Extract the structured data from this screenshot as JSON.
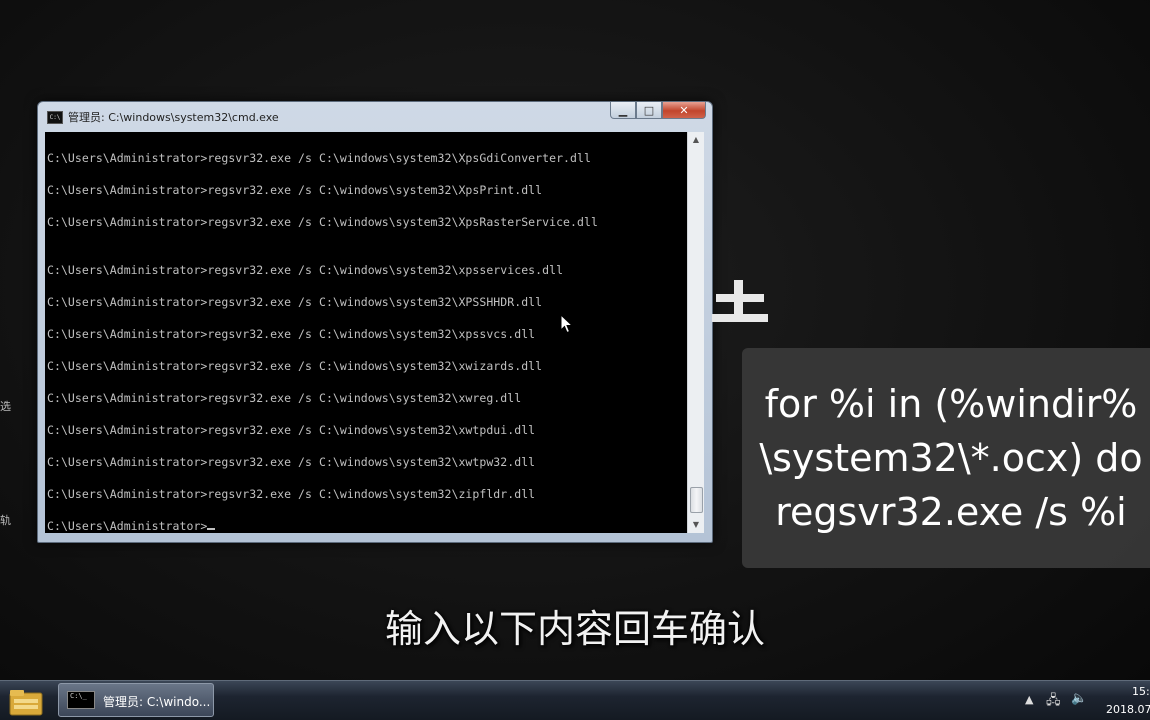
{
  "background": {
    "edge_chars": [
      "选",
      "轨"
    ]
  },
  "cmd_window": {
    "title": "管理员: C:\\windows\\system32\\cmd.exe",
    "icon_label": "C:\\",
    "buttons": {
      "minimize": "▁",
      "maximize": "□",
      "close": "✕"
    },
    "console_lines": [
      "C:\\Users\\Administrator>regsvr32.exe /s C:\\windows\\system32\\XpsGdiConverter.dll",
      "C:\\Users\\Administrator>regsvr32.exe /s C:\\windows\\system32\\XpsPrint.dll",
      "C:\\Users\\Administrator>regsvr32.exe /s C:\\windows\\system32\\XpsRasterService.dll",
      "C:\\Users\\Administrator>regsvr32.exe /s C:\\windows\\system32\\xpsservices.dll",
      "C:\\Users\\Administrator>regsvr32.exe /s C:\\windows\\system32\\XPSSHHDR.dll",
      "C:\\Users\\Administrator>regsvr32.exe /s C:\\windows\\system32\\xpssvcs.dll",
      "C:\\Users\\Administrator>regsvr32.exe /s C:\\windows\\system32\\xwizards.dll",
      "C:\\Users\\Administrator>regsvr32.exe /s C:\\windows\\system32\\xwreg.dll",
      "C:\\Users\\Administrator>regsvr32.exe /s C:\\windows\\system32\\xwtpdui.dll",
      "C:\\Users\\Administrator>regsvr32.exe /s C:\\windows\\system32\\xwtpw32.dll",
      "C:\\Users\\Administrator>regsvr32.exe /s C:\\windows\\system32\\zipfldr.dll"
    ],
    "prompt": "C:\\Users\\Administrator>"
  },
  "info_panel": {
    "lines": [
      "for %i in (%windir%",
      "\\system32\\*.ocx) do",
      "regsvr32.exe /s %i"
    ]
  },
  "subtitle": "输入以下内容回车确认",
  "taskbar": {
    "task_label": "管理员: C:\\windo...",
    "task_icon_label": "C:\\_",
    "tray": {
      "up_arrow": "▲",
      "network": "🖧",
      "volume": "🔈"
    },
    "clock_time": "15:",
    "clock_date": "2018.07"
  },
  "colors": {
    "console_bg": "#000000",
    "console_text": "#c0c0c0",
    "close_button": "#c2452c",
    "panel_bg": "#3a3a3a"
  }
}
